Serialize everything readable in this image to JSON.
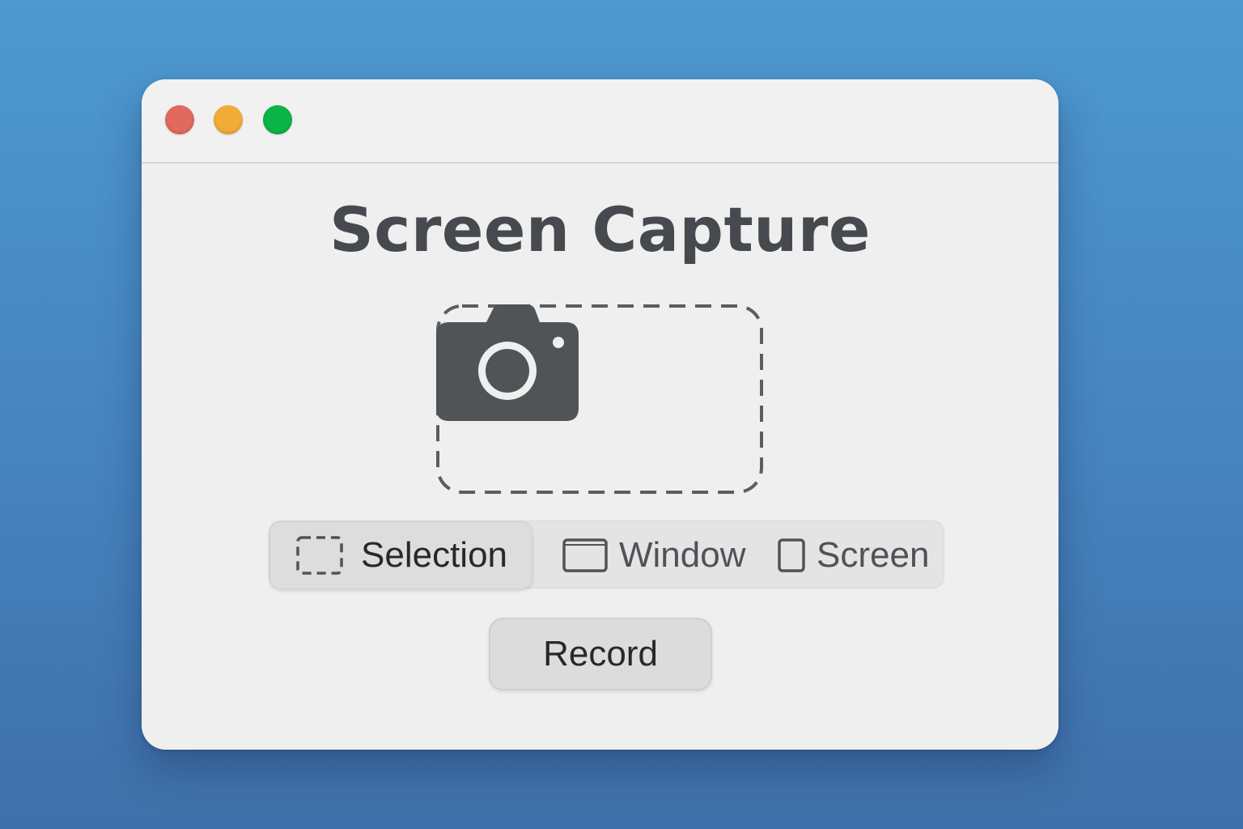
{
  "window": {
    "title": "Screen Capture",
    "traffic_lights": {
      "close": "#e2695d",
      "minimize": "#f0ac36",
      "zoom": "#0bb446"
    }
  },
  "drop_zone": {
    "icon": "camera-icon"
  },
  "capture_modes": {
    "selected": "Selection",
    "items": [
      {
        "label": "Selection",
        "icon": "dashed-rectangle-icon"
      },
      {
        "label": "Window",
        "icon": "window-icon"
      },
      {
        "label": "Screen",
        "icon": "screen-icon"
      }
    ]
  },
  "actions": {
    "record_label": "Record"
  },
  "colors": {
    "desktop": "#4a8cc8",
    "window_bg": "#efefef",
    "text_dark": "#464a4f",
    "icon_dark": "#505457"
  }
}
